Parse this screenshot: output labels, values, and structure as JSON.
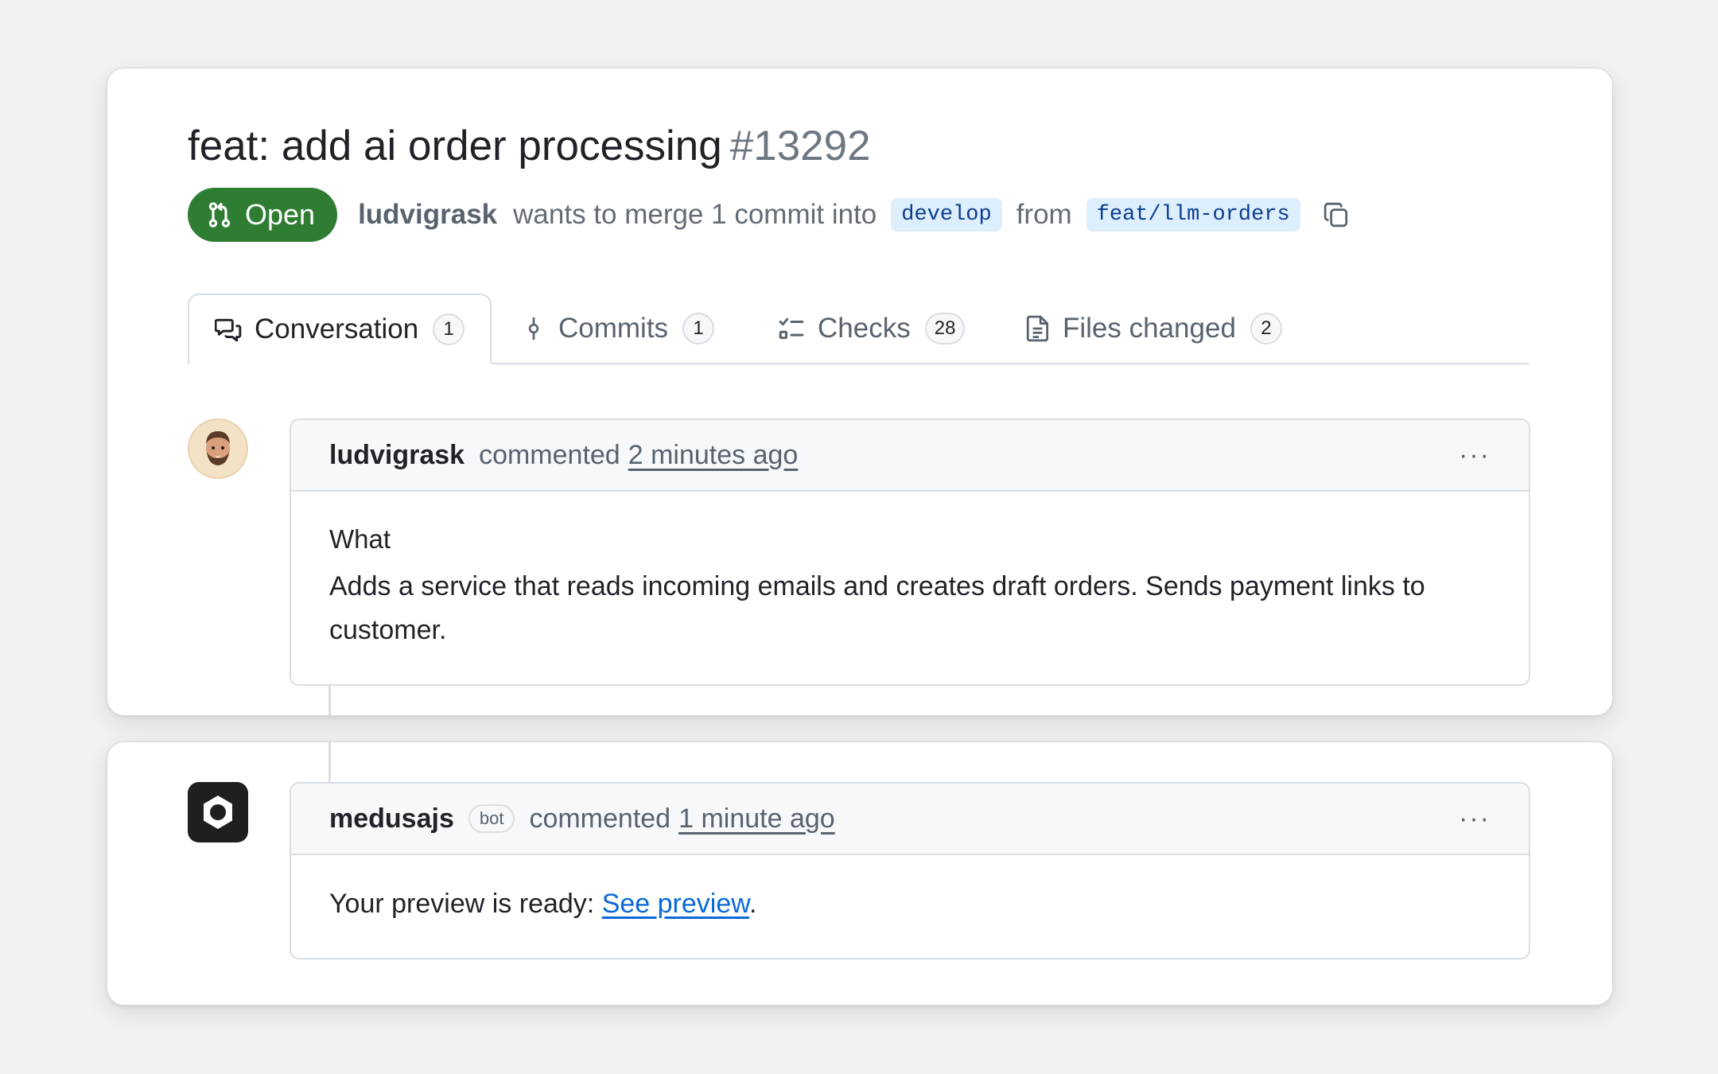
{
  "pr": {
    "title": "feat: add ai order processing",
    "number": "#13292",
    "state": "Open",
    "author": "ludvigrask",
    "merge_text": "wants to merge 1 commit into",
    "base_branch": "develop",
    "from_text": "from",
    "head_branch": "feat/llm-orders"
  },
  "tabs": [
    {
      "label": "Conversation",
      "count": "1",
      "icon": "comment-discussion-icon"
    },
    {
      "label": "Commits",
      "count": "1",
      "icon": "git-commit-icon"
    },
    {
      "label": "Checks",
      "count": "28",
      "icon": "checklist-icon"
    },
    {
      "label": "Files changed",
      "count": "2",
      "icon": "file-diff-icon"
    }
  ],
  "comments": [
    {
      "author": "ludvigrask",
      "verb": "commented",
      "time": "2 minutes ago",
      "menu": "···",
      "heading": "What",
      "body": "Adds a service that reads incoming emails and creates draft orders. Sends payment links to customer."
    },
    {
      "author": "medusajs",
      "bot_label": "bot",
      "verb": "commented",
      "time": "1 minute ago",
      "menu": "···",
      "body_prefix": "Your preview is ready: ",
      "link_text": "See preview",
      "body_suffix": "."
    }
  ],
  "colors": {
    "open_badge": "#2e7d32",
    "branch_bg": "#ddeefc",
    "branch_text": "#0b3d91",
    "link": "#0969da"
  }
}
